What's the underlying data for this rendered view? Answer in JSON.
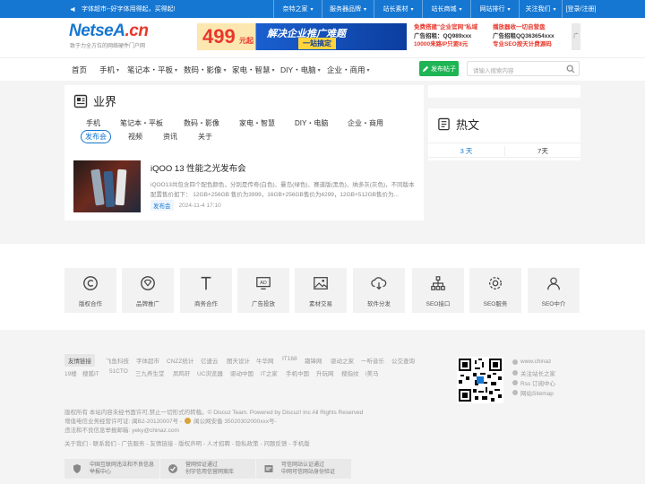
{
  "topbar": {
    "notice": "字体超市--好字体用得起，买得起!",
    "links": [
      "奈特之家",
      "服务器品牌",
      "站长素材",
      "站长商城",
      "网站排行",
      "关注我们",
      "[登录/注册]"
    ]
  },
  "header": {
    "logo_main": "NetseA",
    "logo_dot": ".cn",
    "slogan": "致于力全方位的网络硬件门户网",
    "banner": {
      "num": "499",
      "unit": "元起",
      "title": "解决企业推广难题",
      "subtitle": "一站搞定"
    },
    "ad_left": [
      "免费搭建\"企业官网\"私域",
      "广告招租：QQ989xxx",
      "10000来路IP只要8元"
    ],
    "ad_right": [
      "播放器收一切自营盘",
      "广告招租QQ363654xxx",
      "专业SEO按天计费源码"
    ],
    "ad_tag": "广告"
  },
  "nav": {
    "items": [
      "首页",
      "手机",
      "笔记本・平板",
      "数码・影像",
      "家电・智慧",
      "DIY・电脑",
      "企业・商用"
    ],
    "post_button": "发布帖子",
    "search_placeholder": "请输入搜索内容"
  },
  "section": {
    "title": "业界",
    "subnav_row1": [
      "手机",
      "笔记本・平板",
      "数码・影像",
      "家电・智慧",
      "DIY・电脑",
      "企业・商用"
    ],
    "subnav_row2": [
      "发布会",
      "视频",
      "资讯",
      "关于"
    ],
    "active_tab": "发布会"
  },
  "article": {
    "title": "iQOO 13 性能之光发布会",
    "summary": "iQOO13共包含四个配色颜色，分别是传奇(白色)、曼岛(绿色)、赛道版(黑色)、纳多灰(灰色)，不同版本配置售价如下： 12GB+256GB 售价为3999，16GB+256GB售价为4299，12GB+512GB售价为...",
    "category": "发布会",
    "date": "2024-11-4 17:10"
  },
  "hot": {
    "title": "热文",
    "tabs": [
      "3 天",
      "7天"
    ]
  },
  "services": [
    "版权合作",
    "品牌推广",
    "商务合作",
    "广告投放",
    "素材交易",
    "软件分发",
    "SEO接口",
    "SEO服务",
    "SEO中介"
  ],
  "footer": {
    "links_label": "友情链接",
    "links_row1": [
      "飞鱼科技",
      "字体超市",
      "CNZZ统计",
      "亿速云",
      "图天设计",
      "牛华网",
      "IT168",
      "霜锋网",
      "驱动之家",
      "一听音乐",
      "公交查询"
    ],
    "links_row2": [
      "19楼",
      "搜狐IT",
      "51CTO",
      "三九养生堂",
      "凤鸣轩",
      "UC浏览器",
      "驱动中国",
      "IT之家",
      "手机中国",
      "升玩网",
      "搜指纹",
      "i美马"
    ],
    "copyright": "版权所有 本站内容未经书面许可,禁止一切形式的转载。© Discuz Team. Powered by Discuz! Inc All Rights Reserved",
    "icp": "增值电信业务经营许可证: 闽B2-20120007号 -",
    "police": "闽公网安备 35020302000xxx号-",
    "report": "违法和不良信息举报邮箱: yeky@chinaz.com",
    "bottom_links": "关于我们 - 联系我们 - 广告服务 - 友情链接 - 版权声明 - 人才招聘 - 隐私政策 - 问题反馈 - 手机版",
    "social": [
      "www.chinaz",
      "关注站长之家",
      "Rss 订阅中心",
      "网站Sitemap"
    ],
    "badges": [
      [
        "中国互联网违法和不良信息",
        "举报中心"
      ],
      [
        "营网验证通过",
        "创宇信用信营网案库"
      ],
      [
        "可信网站认证通过",
        "中网可信网站身份验证"
      ]
    ]
  }
}
